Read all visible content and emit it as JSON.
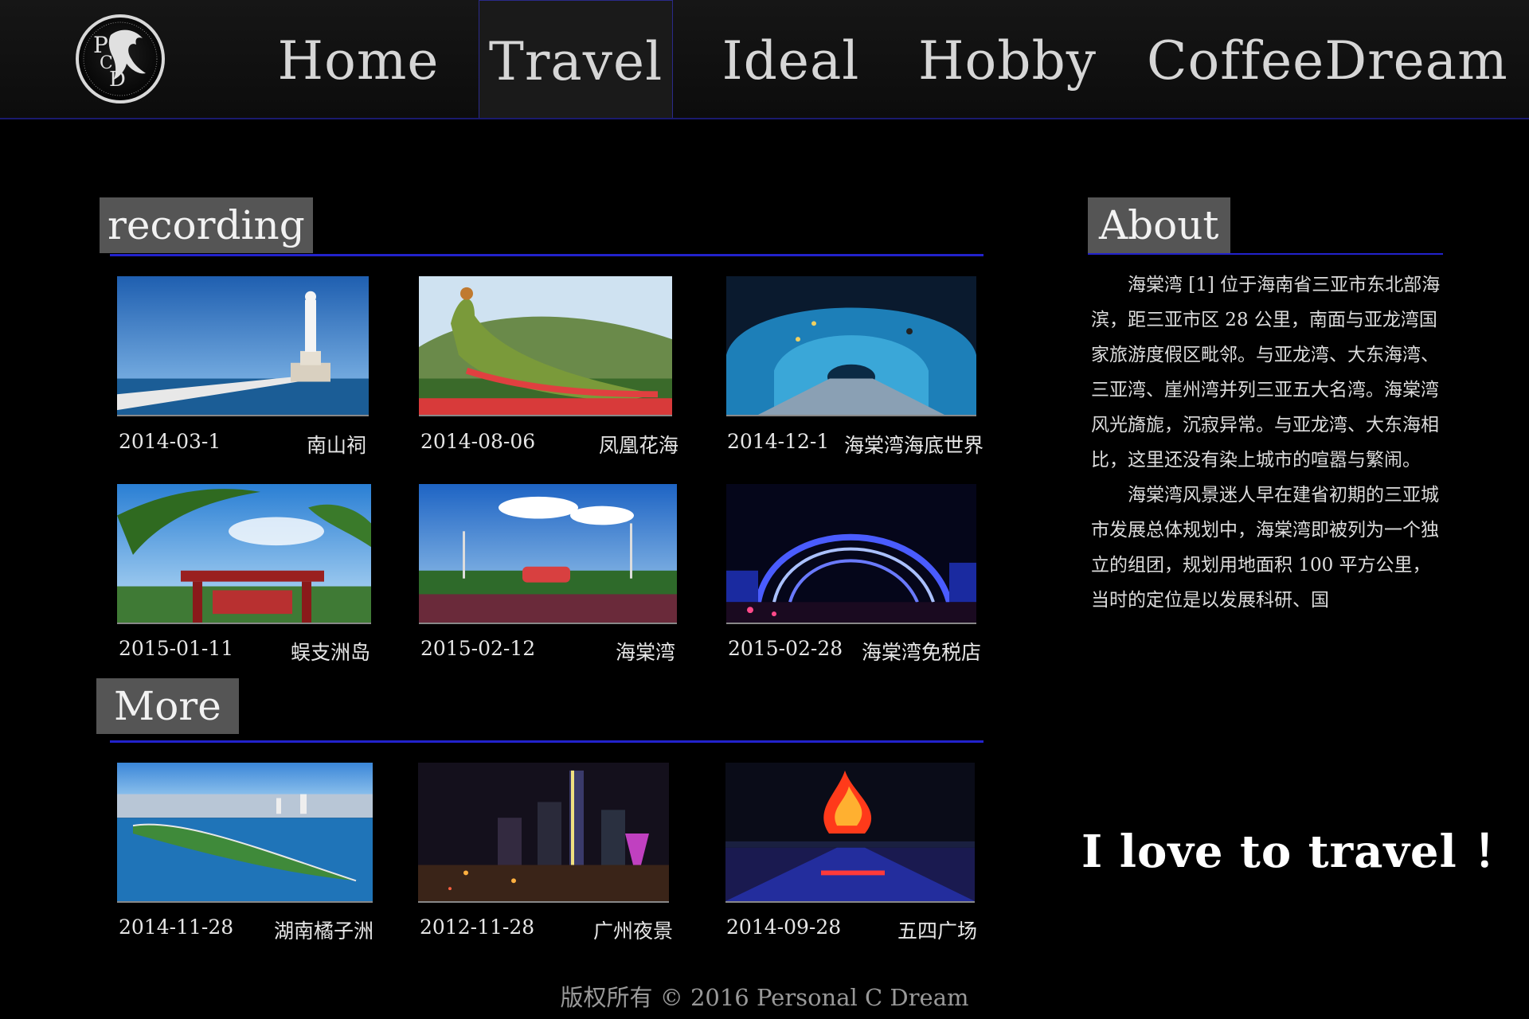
{
  "nav": {
    "logo_text": "PCD",
    "items": [
      {
        "label": "Home",
        "active": false
      },
      {
        "label": "Travel",
        "active": true
      },
      {
        "label": "Ideal",
        "active": false
      },
      {
        "label": "Hobby",
        "active": false
      },
      {
        "label": "CoffeeDream",
        "active": false
      }
    ]
  },
  "recording": {
    "heading": "recording",
    "items": [
      {
        "date": "2014-03-1",
        "place": "南山祠",
        "image": "guanyin-statue-seaside-photo"
      },
      {
        "date": "2014-08-06",
        "place": "凤凰花海",
        "image": "phoenix-flower-sculpture-photo"
      },
      {
        "date": "2014-12-1",
        "place": "海棠湾海底世界",
        "image": "underwater-aquarium-tunnel-photo"
      },
      {
        "date": "2015-01-11",
        "place": "蜈支洲岛",
        "image": "palm-trees-red-gate-photo"
      },
      {
        "date": "2015-02-12",
        "place": "海棠湾",
        "image": "haitang-bay-garden-sign-photo"
      },
      {
        "date": "2015-02-28",
        "place": "海棠湾免税店",
        "image": "duty-free-mall-night-arch-photo"
      }
    ]
  },
  "more": {
    "heading": "More",
    "items": [
      {
        "date": "2014-11-28",
        "place": "湖南橘子洲",
        "image": "river-island-aerial-photo"
      },
      {
        "date": "2012-11-28",
        "place": "广州夜景",
        "image": "guangzhou-night-skyline-photo"
      },
      {
        "date": "2014-09-28",
        "place": "五四广场",
        "image": "may-fourth-square-night-photo"
      }
    ]
  },
  "about": {
    "heading": "About",
    "paragraphs": [
      "海棠湾 [1] 位于海南省三亚市东北部海滨，距三亚市区 28 公里，南面与亚龙湾国家旅游度假区毗邻。与亚龙湾、大东海湾、三亚湾、崖州湾并列三亚五大名湾。海棠湾风光旖旎，沉寂异常。与亚龙湾、大东海相比，这里还没有染上城市的喧嚣与繁闹。",
      "海棠湾风景迷人早在建省初期的三亚城市发展总体规划中，海棠湾即被列为一个独立的组团，规划用地面积 100 平方公里，当时的定位是以发展科研、国"
    ]
  },
  "slogan": "I love to travel ！",
  "footer": "版权所有 © 2016 Personal C Dream",
  "colors": {
    "accent_line": "#2222cc",
    "heading_bg": "#555555",
    "background": "#000000"
  }
}
